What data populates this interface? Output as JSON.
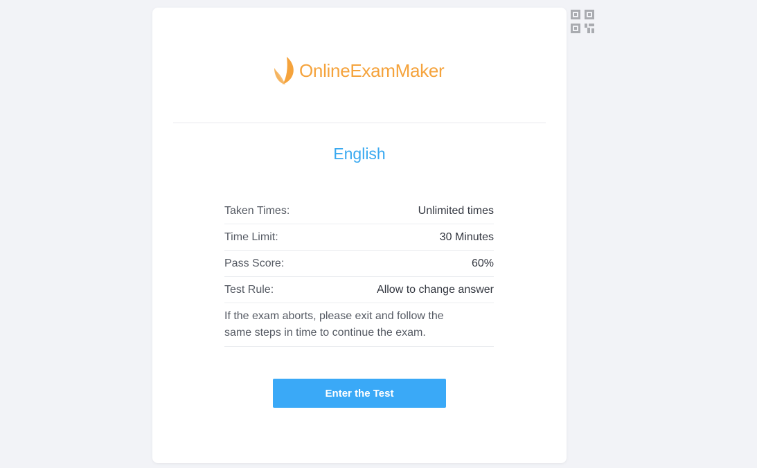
{
  "logo": {
    "text": "OnlineExamMaker",
    "icon": "leaf-logo-icon",
    "color": "#f5a33c"
  },
  "qr_icon": "qr-code-icon",
  "exam": {
    "title": "English",
    "title_color": "#3aa9f0"
  },
  "info_rows": [
    {
      "label": "Taken Times:",
      "value": "Unlimited times"
    },
    {
      "label": "Time Limit:",
      "value": "30 Minutes"
    },
    {
      "label": "Pass Score:",
      "value": "60%"
    },
    {
      "label": "Test Rule:",
      "value": "Allow to change answer"
    }
  ],
  "note": "If the exam aborts, please exit and follow the same steps in time to continue the exam.",
  "enter_button": {
    "label": "Enter the Test",
    "color": "#3aa9f7"
  }
}
